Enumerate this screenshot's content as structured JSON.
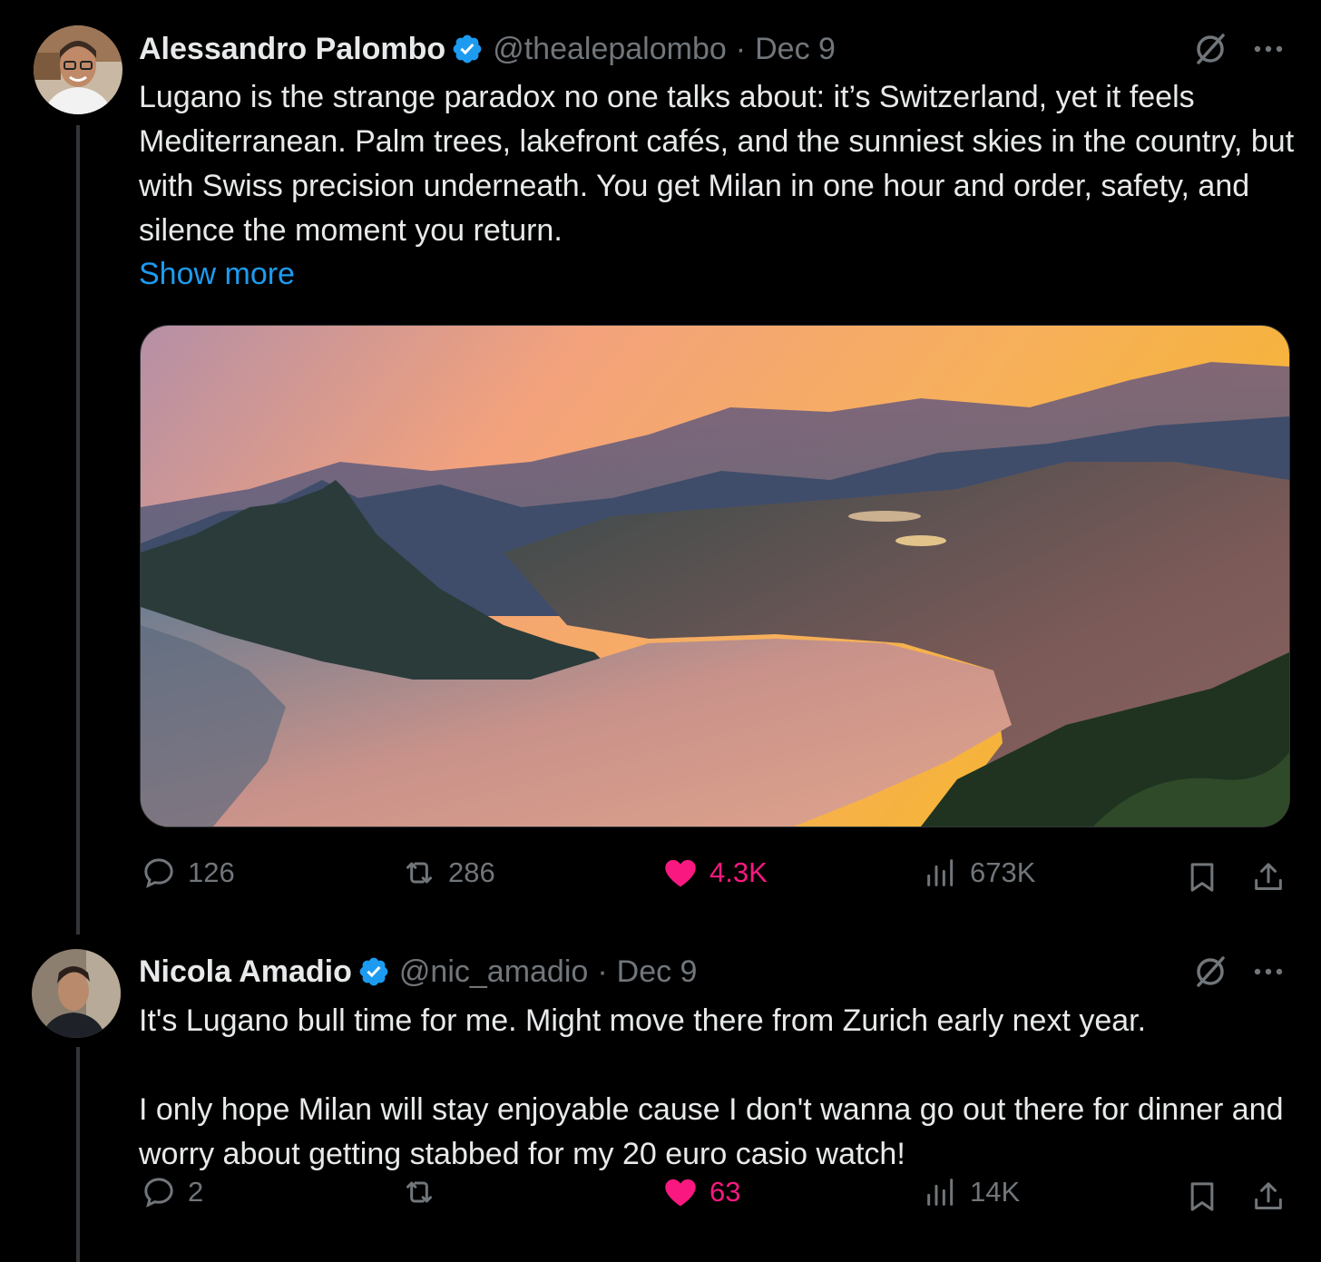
{
  "colors": {
    "background": "#000000",
    "text": "#e7e9ea",
    "muted": "#71767b",
    "link": "#1d9bf0",
    "like": "#f91880",
    "verified": "#1d9bf0"
  },
  "tweets": [
    {
      "name": "Alessandro Palombo",
      "handle": "@thealepalombo",
      "separator": "·",
      "date": "Dec 9",
      "text": "Lugano is the strange paradox no one talks about: it’s Switzerland, yet it feels Mediterranean. Palm trees, lakefront cafés, and the sunniest skies in the country, but with Swiss precision underneath. You get Milan in one hour and order, safety, and silence the moment you return.",
      "show_more": "Show more",
      "icons": [
        "grok-icon",
        "more-icon",
        "verified-badge-icon"
      ],
      "media": "aerial photo of Lake Lugano at sunset",
      "stats": {
        "replies": "126",
        "reposts": "286",
        "likes": "4.3K",
        "views": "673K"
      }
    },
    {
      "name": "Nicola Amadio",
      "handle": "@nic_amadio",
      "separator": "·",
      "date": "Dec 9",
      "text": "It's Lugano bull time for me. Might move there from Zurich early next year.\n\nI only hope Milan will stay enjoyable cause I don't wanna go out there for dinner and worry about getting stabbed for my 20 euro casio watch!",
      "icons": [
        "grok-icon",
        "more-icon",
        "verified-badge-icon"
      ],
      "stats": {
        "replies": "2",
        "reposts": "",
        "likes": "63",
        "views": "14K"
      }
    }
  ]
}
